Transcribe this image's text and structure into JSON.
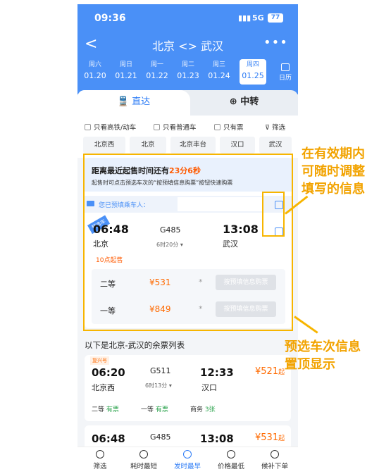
{
  "status": {
    "time": "09:36",
    "signal": "5G",
    "battery": "77"
  },
  "nav": {
    "back": "<",
    "title": "北京 <> 武汉",
    "more": "•••"
  },
  "dates": [
    {
      "weekday": "周六",
      "date": "01.20"
    },
    {
      "weekday": "周日",
      "date": "01.21"
    },
    {
      "weekday": "周一",
      "date": "01.22"
    },
    {
      "weekday": "周二",
      "date": "01.23"
    },
    {
      "weekday": "周三",
      "date": "01.24"
    },
    {
      "weekday": "周四",
      "date": "01.25"
    }
  ],
  "calendar_label": "日历",
  "tabs": {
    "direct": "直达",
    "transfer": "中转"
  },
  "filters": {
    "high_speed": "只看高铁/动车",
    "normal": "只看普通车",
    "has_ticket": "只有票",
    "filter": "筛选"
  },
  "stations": [
    "北京西",
    "北京",
    "北京丰台",
    "汉口",
    "武汉"
  ],
  "preselect": {
    "countdown_prefix": "距离最近起售时间还有",
    "countdown": "23分6秒",
    "hint": "起售时可点击预选车次的“按预填信息购票”按钮快速购票",
    "passenger_label": "您已预填乘车人：",
    "badge": "预选车",
    "train": {
      "depart_time": "06:48",
      "depart_station": "北京",
      "code": "G485",
      "duration": "6时20分",
      "arrive_time": "13:08",
      "arrive_station": "武汉",
      "sale_time": "10点起售"
    },
    "seats": [
      {
        "class": "二等",
        "price": "¥531",
        "dot": "*",
        "button": "按预填信息购票"
      },
      {
        "class": "一等",
        "price": "¥849",
        "dot": "*",
        "button": "按预填信息购票"
      }
    ]
  },
  "list_title": "以下是北京-武汉的余票列表",
  "trains": [
    {
      "tag": "复兴号",
      "depart_time": "06:20",
      "depart_station": "北京西",
      "code": "G511",
      "duration": "6时13分",
      "arrive_time": "12:33",
      "arrive_station": "汉口",
      "price": "¥521",
      "price_suffix": "起",
      "availability": [
        {
          "class": "二等",
          "status": "有票"
        },
        {
          "class": "一等",
          "status": "有票"
        },
        {
          "class": "商务",
          "status": "3张"
        }
      ]
    },
    {
      "depart_time": "06:48",
      "code": "G485",
      "arrive_time": "13:08",
      "price": "¥531",
      "price_suffix": "起"
    }
  ],
  "bottom": [
    "筛选",
    "耗时最短",
    "发时最早",
    "价格最低",
    "候补下单"
  ],
  "annotations": {
    "note1": [
      "在有效期内",
      "可随时调整",
      "填写的信息"
    ],
    "note2": [
      "预选车次信息",
      "置顶显示"
    ]
  },
  "colors": {
    "primary": "#4a90f7",
    "accent": "#ff6a00",
    "highlight": "#f7b500"
  }
}
